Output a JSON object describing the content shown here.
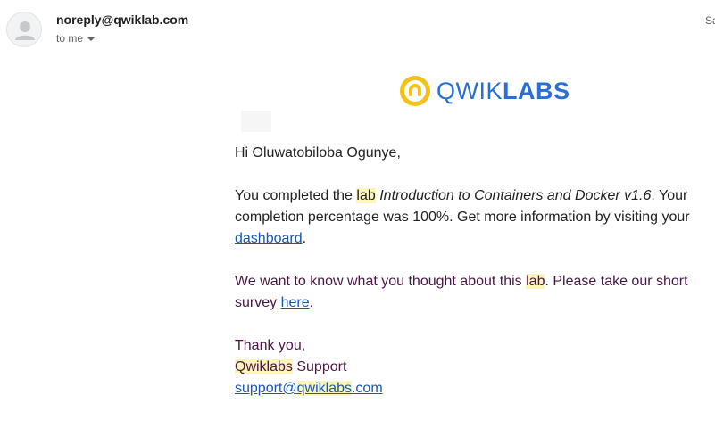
{
  "header": {
    "sender": "noreply@qwiklab.com",
    "to_label": "to me",
    "date_partial": "Sa"
  },
  "logo": {
    "icon": "qwiklabs-logo-icon",
    "word_light": "QWIK",
    "word_bold": "LABS",
    "colors": {
      "ring": "#f2c21b",
      "text": "#2a6fd6"
    }
  },
  "message": {
    "greeting": "Hi Oluwatobiloba Ogunye,",
    "p1_pre": "You completed the ",
    "p1_lab": "lab",
    "p1_space": " ",
    "p1_title": "Introduction to Containers and Docker v1.6",
    "p1_post": ". Your completion percentage was 100%. Get more information by visiting your ",
    "p1_link": "dashboard",
    "p1_end": ".",
    "p2_pre": "We want to know what you thought about this ",
    "p2_lab": "lab",
    "p2_post": ". Please take our short survey ",
    "p2_link": "here",
    "p2_end": ".",
    "thanks": "Thank you,",
    "sig_brand": "Qwiklabs",
    "sig_support": " Support",
    "email_pre": "support@",
    "email_brand": "qwiklabs",
    "email_post": ".com"
  }
}
